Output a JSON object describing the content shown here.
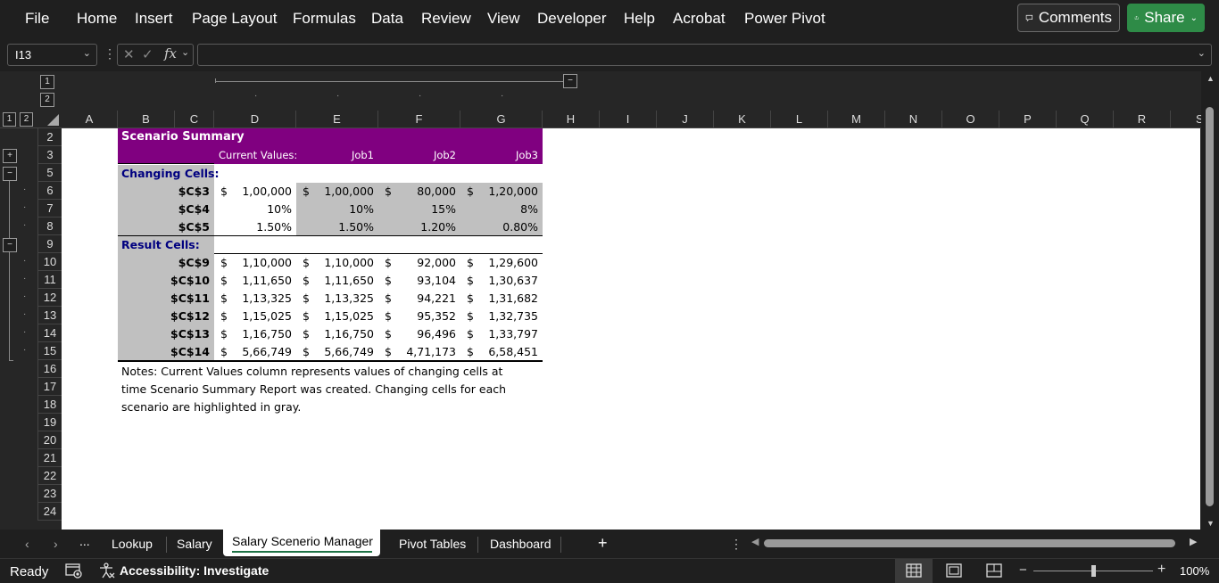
{
  "ribbon": {
    "tabs": [
      "File",
      "Home",
      "Insert",
      "Page Layout",
      "Formulas",
      "Data",
      "Review",
      "View",
      "Developer",
      "Help",
      "Acrobat",
      "Power Pivot"
    ],
    "comments_label": "Comments",
    "share_label": "Share"
  },
  "formula_bar": {
    "name_box": "I13",
    "formula": ""
  },
  "outline": {
    "row_levels": [
      "1",
      "2"
    ],
    "col_levels": [
      "1",
      "2"
    ]
  },
  "columns": [
    "A",
    "B",
    "C",
    "D",
    "E",
    "F",
    "G",
    "H",
    "I",
    "J",
    "K",
    "L",
    "M",
    "N",
    "O",
    "P",
    "Q",
    "R",
    "S"
  ],
  "rows": [
    "2",
    "3",
    "5",
    "6",
    "7",
    "8",
    "9",
    "10",
    "11",
    "12",
    "13",
    "14",
    "15",
    "16",
    "17",
    "18",
    "19",
    "20",
    "21",
    "22",
    "23",
    "24"
  ],
  "sheet": {
    "title": "Scenario Summary",
    "header": {
      "current": "Current Values:",
      "job1": "Job1",
      "job2": "Job2",
      "job3": "Job3"
    },
    "changing_label": "Changing Cells:",
    "result_label": "Result Cells:",
    "changing": [
      {
        "ref": "$C$3",
        "cur_sym": "$",
        "cur": "1,00,000",
        "j1_sym": "$",
        "j1": "1,00,000",
        "j2_sym": "$",
        "j2": "80,000",
        "j3_sym": "$",
        "j3": "1,20,000"
      },
      {
        "ref": "$C$4",
        "cur_sym": "",
        "cur": "10%",
        "j1_sym": "",
        "j1": "10%",
        "j2_sym": "",
        "j2": "15%",
        "j3_sym": "",
        "j3": "8%"
      },
      {
        "ref": "$C$5",
        "cur_sym": "",
        "cur": "1.50%",
        "j1_sym": "",
        "j1": "1.50%",
        "j2_sym": "",
        "j2": "1.20%",
        "j3_sym": "",
        "j3": "0.80%"
      }
    ],
    "results": [
      {
        "ref": "$C$9",
        "cur_sym": "$",
        "cur": "1,10,000",
        "j1_sym": "$",
        "j1": "1,10,000",
        "j2_sym": "$",
        "j2": "92,000",
        "j3_sym": "$",
        "j3": "1,29,600"
      },
      {
        "ref": "$C$10",
        "cur_sym": "$",
        "cur": "1,11,650",
        "j1_sym": "$",
        "j1": "1,11,650",
        "j2_sym": "$",
        "j2": "93,104",
        "j3_sym": "$",
        "j3": "1,30,637"
      },
      {
        "ref": "$C$11",
        "cur_sym": "$",
        "cur": "1,13,325",
        "j1_sym": "$",
        "j1": "1,13,325",
        "j2_sym": "$",
        "j2": "94,221",
        "j3_sym": "$",
        "j3": "1,31,682"
      },
      {
        "ref": "$C$12",
        "cur_sym": "$",
        "cur": "1,15,025",
        "j1_sym": "$",
        "j1": "1,15,025",
        "j2_sym": "$",
        "j2": "95,352",
        "j3_sym": "$",
        "j3": "1,32,735"
      },
      {
        "ref": "$C$13",
        "cur_sym": "$",
        "cur": "1,16,750",
        "j1_sym": "$",
        "j1": "1,16,750",
        "j2_sym": "$",
        "j2": "96,496",
        "j3_sym": "$",
        "j3": "1,33,797"
      },
      {
        "ref": "$C$14",
        "cur_sym": "$",
        "cur": "5,66,749",
        "j1_sym": "$",
        "j1": "5,66,749",
        "j2_sym": "$",
        "j2": "4,71,173",
        "j3_sym": "$",
        "j3": "6,58,451"
      }
    ],
    "notes": [
      "Notes:  Current Values column represents values of changing cells at",
      "time Scenario Summary Report was created.  Changing cells for each",
      "scenario are highlighted in gray."
    ]
  },
  "sheet_tabs": {
    "ellipsis": "...",
    "tabs": [
      "Lookup",
      "Salary",
      "Salary Scenerio Manager",
      "Pivot Tables",
      "Dashboard"
    ],
    "active": "Salary Scenerio Manager",
    "add": "+"
  },
  "status": {
    "ready": "Ready",
    "accessibility": "Accessibility: Investigate",
    "zoom": "100%",
    "zoom_minus": "−",
    "zoom_plus": "+"
  },
  "colors": {
    "purple_header": "#800080",
    "gray_fill": "#c0c0c0",
    "navy_label": "#000080",
    "share_green": "#2e8b47"
  }
}
